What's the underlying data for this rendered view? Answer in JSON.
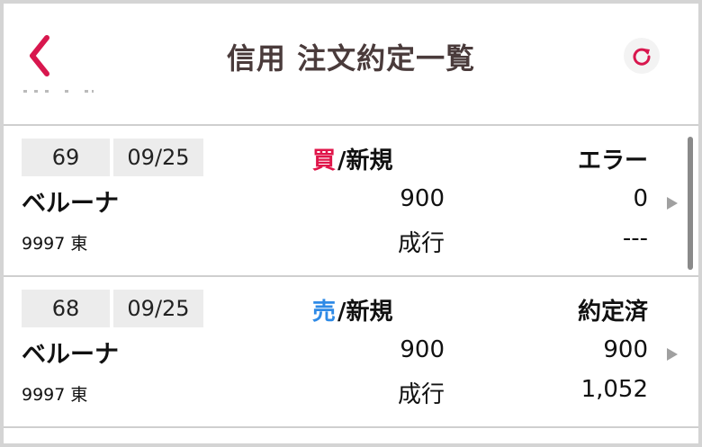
{
  "header": {
    "title": "信用 注文約定一覧",
    "back_icon": "chevron-left-icon",
    "refresh_icon": "refresh-icon"
  },
  "colors": {
    "accent": "#d8174e",
    "buy": "#e0164a",
    "sell": "#2e8ae6",
    "title": "#4a3b3b"
  },
  "orders": [
    {
      "no": "69",
      "date": "09/25",
      "side": "買",
      "kind": "/新規",
      "status": "エラー",
      "name": "ベルーナ",
      "qty": "900",
      "exec_qty": "0",
      "code": "9997 東",
      "order_type": "成行",
      "price": "---"
    },
    {
      "no": "68",
      "date": "09/25",
      "side": "売",
      "kind": "/新規",
      "status": "約定済",
      "name": "ベルーナ",
      "qty": "900",
      "exec_qty": "900",
      "code": "9997 東",
      "order_type": "成行",
      "price": "1,052"
    }
  ]
}
